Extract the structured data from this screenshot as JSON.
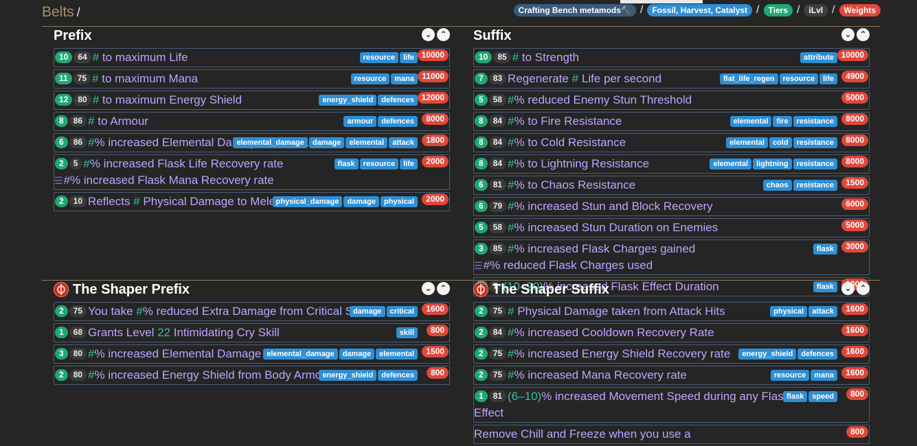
{
  "breadcrumb": {
    "title": "Belts",
    "sep": "/"
  },
  "filters": [
    {
      "label": "Crafting Bench metamods🔨",
      "style": "dark"
    },
    {
      "label": "Fossil, Harvest, Catalyst",
      "style": "blue"
    },
    {
      "label": "Tiers",
      "style": "green"
    },
    {
      "label": "iLvl",
      "style": "gray"
    },
    {
      "label": "Weights",
      "style": "red"
    }
  ],
  "filter_sep": "/",
  "chevrons": {
    "down": "⌄",
    "up": "⌃"
  },
  "list_icon": "☰",
  "sections": [
    {
      "key": "prefix",
      "title": "Prefix",
      "icon": false,
      "rows": [
        {
          "tier": "10",
          "ilvl": "64",
          "text": [
            [
              "hl",
              "# "
            ],
            [
              "",
              "to maximum Life"
            ]
          ],
          "tags": [
            "resource",
            "life"
          ],
          "weight": "10000"
        },
        {
          "tier": "11",
          "ilvl": "75",
          "text": [
            [
              "hl",
              "# "
            ],
            [
              "",
              "to maximum Mana"
            ]
          ],
          "tags": [
            "resource",
            "mana"
          ],
          "weight": "11000"
        },
        {
          "tier": "12",
          "ilvl": "80",
          "text": [
            [
              "hl",
              "# "
            ],
            [
              "",
              "to maximum Energy Shield"
            ]
          ],
          "tags": [
            "energy_shield",
            "defences"
          ],
          "weight": "12000"
        },
        {
          "tier": "8",
          "ilvl": "86",
          "text": [
            [
              "hl",
              "# "
            ],
            [
              "",
              "to Armour"
            ]
          ],
          "tags": [
            "armour",
            "defences"
          ],
          "weight": "8000"
        },
        {
          "tier": "6",
          "ilvl": "86",
          "text": [
            [
              "hl",
              "#"
            ],
            [
              "",
              "% increased Elemental Damage with Attack Skills"
            ]
          ],
          "tags": [
            "elemental_damage",
            "damage",
            "elemental",
            "attack"
          ],
          "weight": "1800"
        },
        {
          "tier": "2",
          "ilvl": "5",
          "text": [
            [
              "hl",
              "#"
            ],
            [
              "",
              "% increased Flask Life Recovery rate"
            ]
          ],
          "line2": [
            [
              "hl",
              "#"
            ],
            [
              "",
              "% increased Flask Mana Recovery rate"
            ]
          ],
          "tags": [
            "flask",
            "resource",
            "life"
          ],
          "weight": "2000"
        },
        {
          "tier": "2",
          "ilvl": "10",
          "text": [
            [
              "",
              "Reflects "
            ],
            [
              "hl",
              "# "
            ],
            [
              "",
              "Physical Damage to Melee Attackers"
            ]
          ],
          "tags": [
            "physical_damage",
            "damage",
            "physical"
          ],
          "weight": "2000"
        }
      ]
    },
    {
      "key": "suffix",
      "title": "Suffix",
      "icon": false,
      "rows": [
        {
          "tier": "10",
          "ilvl": "85",
          "text": [
            [
              "hl",
              "# "
            ],
            [
              "",
              "to Strength"
            ]
          ],
          "tags": [
            "attribute"
          ],
          "weight": "10000"
        },
        {
          "tier": "7",
          "ilvl": "83",
          "text": [
            [
              "",
              "Regenerate "
            ],
            [
              "hl",
              "# "
            ],
            [
              "",
              "Life per second"
            ]
          ],
          "tags": [
            "flat_life_regen",
            "resource",
            "life"
          ],
          "weight": "4900"
        },
        {
          "tier": "5",
          "ilvl": "58",
          "text": [
            [
              "hl",
              "#"
            ],
            [
              "",
              "% reduced Enemy Stun Threshold"
            ]
          ],
          "tags": [],
          "weight": "5000"
        },
        {
          "tier": "8",
          "ilvl": "84",
          "text": [
            [
              "hl",
              "#"
            ],
            [
              "",
              "% to Fire Resistance"
            ]
          ],
          "tags": [
            "elemental",
            "fire",
            "resistance"
          ],
          "weight": "8000"
        },
        {
          "tier": "8",
          "ilvl": "84",
          "text": [
            [
              "hl",
              "#"
            ],
            [
              "",
              "% to Cold Resistance"
            ]
          ],
          "tags": [
            "elemental",
            "cold",
            "resistance"
          ],
          "weight": "8000"
        },
        {
          "tier": "8",
          "ilvl": "84",
          "text": [
            [
              "hl",
              "#"
            ],
            [
              "",
              "% to Lightning Resistance"
            ]
          ],
          "tags": [
            "elemental",
            "lightning",
            "resistance"
          ],
          "weight": "8000"
        },
        {
          "tier": "6",
          "ilvl": "81",
          "text": [
            [
              "hl",
              "#"
            ],
            [
              "",
              "% to Chaos Resistance"
            ]
          ],
          "tags": [
            "chaos",
            "resistance"
          ],
          "weight": "1500"
        },
        {
          "tier": "6",
          "ilvl": "79",
          "text": [
            [
              "hl",
              "#"
            ],
            [
              "",
              "% increased Stun and Block Recovery"
            ]
          ],
          "tags": [],
          "weight": "6000"
        },
        {
          "tier": "5",
          "ilvl": "58",
          "text": [
            [
              "hl",
              "#"
            ],
            [
              "",
              "% increased Stun Duration on Enemies"
            ]
          ],
          "tags": [],
          "weight": "5000"
        },
        {
          "tier": "3",
          "ilvl": "85",
          "text": [
            [
              "hl",
              "#"
            ],
            [
              "",
              "% increased Flask Charges gained"
            ]
          ],
          "line2": [
            [
              "hl",
              "#"
            ],
            [
              "",
              "% reduced Flask Charges used"
            ]
          ],
          "tags": [
            "flask"
          ],
          "weight": "3000"
        },
        {
          "tier": "1",
          "ilvl": "7",
          "text": [
            [
              "hl",
              "(10–20)"
            ],
            [
              "",
              "% increased Flask Effect Duration"
            ]
          ],
          "tags": [
            "flask"
          ],
          "weight": "1000"
        }
      ]
    },
    {
      "key": "shaper-prefix",
      "title": "The Shaper Prefix",
      "icon": true,
      "rows": [
        {
          "tier": "2",
          "ilvl": "75",
          "text": [
            [
              "",
              "You take "
            ],
            [
              "hl",
              "#"
            ],
            [
              "",
              "% reduced Extra Damage from Critical Strikes"
            ]
          ],
          "tags": [
            "damage",
            "critical"
          ],
          "weight": "1600"
        },
        {
          "tier": "1",
          "ilvl": "68",
          "text": [
            [
              "",
              "Grants Level "
            ],
            [
              "hl",
              "22 "
            ],
            [
              "",
              "Intimidating Cry Skill"
            ]
          ],
          "tags": [
            "skill"
          ],
          "weight": "800"
        },
        {
          "tier": "3",
          "ilvl": "80",
          "text": [
            [
              "hl",
              "#"
            ],
            [
              "",
              "% increased Elemental Damage"
            ]
          ],
          "tags": [
            "elemental_damage",
            "damage",
            "elemental"
          ],
          "weight": "1500"
        },
        {
          "tier": "2",
          "ilvl": "80",
          "text": [
            [
              "hl",
              "#"
            ],
            [
              "",
              "% increased Energy Shield from Body Armour"
            ]
          ],
          "tags": [
            "energy_shield",
            "defences"
          ],
          "weight": "800"
        }
      ]
    },
    {
      "key": "shaper-suffix",
      "title": "The Shaper Suffix",
      "icon": true,
      "rows": [
        {
          "tier": "2",
          "ilvl": "75",
          "text": [
            [
              "hl",
              "# "
            ],
            [
              "",
              "Physical Damage taken from Attack Hits"
            ]
          ],
          "tags": [
            "physical",
            "attack"
          ],
          "weight": "1600"
        },
        {
          "tier": "2",
          "ilvl": "84",
          "text": [
            [
              "hl",
              "#"
            ],
            [
              "",
              "% increased Cooldown Recovery Rate"
            ]
          ],
          "tags": [],
          "weight": "1600"
        },
        {
          "tier": "2",
          "ilvl": "75",
          "text": [
            [
              "hl",
              "#"
            ],
            [
              "",
              "% increased Energy Shield Recovery rate"
            ]
          ],
          "tags": [
            "energy_shield",
            "defences"
          ],
          "weight": "1600"
        },
        {
          "tier": "2",
          "ilvl": "75",
          "text": [
            [
              "hl",
              "#"
            ],
            [
              "",
              "% increased Mana Recovery rate"
            ]
          ],
          "tags": [
            "resource",
            "mana"
          ],
          "weight": "1600"
        },
        {
          "tier": "1",
          "ilvl": "81",
          "text": [
            [
              "hl",
              "(6–10)"
            ],
            [
              "",
              "% increased Movement Speed during any Flask Effect"
            ]
          ],
          "tags": [
            "flask",
            "speed"
          ],
          "weight": "800"
        },
        {
          "tier": "",
          "ilvl": "",
          "text": [
            [
              "",
              "Remove Chill and Freeze when you use a"
            ]
          ],
          "tags": [],
          "weight": "800"
        }
      ]
    }
  ]
}
